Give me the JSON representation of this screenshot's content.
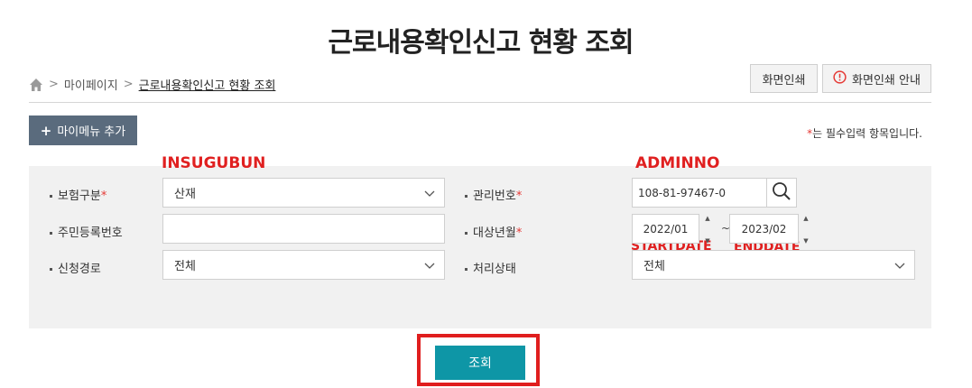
{
  "page": {
    "title": "근로내용확인신고 현황 조회"
  },
  "breadcrumb": {
    "items": [
      "마이페이지",
      "근로내용확인신고 현황 조회"
    ]
  },
  "toolbar": {
    "print_label": "화면인쇄",
    "print_guide_label": "화면인쇄 안내"
  },
  "mymenu": {
    "add_label": "마이메뉴 추가"
  },
  "notice": {
    "required_mark": "*",
    "required_text": "는 필수입력 항목입니다."
  },
  "annotations": {
    "insugubun": "INSUGUBUN",
    "adminno": "ADMINNO",
    "startdate": "STARTDATE",
    "enddate": "ENDDATE"
  },
  "form": {
    "insurance_type": {
      "label": "보험구분",
      "required": "*",
      "value": "산재"
    },
    "resident_no": {
      "label": "주민등록번호",
      "value": ""
    },
    "channel": {
      "label": "신청경로",
      "value": "전체"
    },
    "admin_no": {
      "label": "관리번호",
      "required": "*",
      "value": "108-81-97467-0"
    },
    "target_month": {
      "label": "대상년월",
      "required": "*",
      "start": "2022/01",
      "end": "2023/02",
      "separator": "~"
    },
    "status": {
      "label": "처리상태",
      "value": "전체"
    }
  },
  "actions": {
    "search_label": "조회"
  },
  "colors": {
    "accent": "#0e96a6",
    "annotation": "#e02020",
    "panel_bg": "#f1f1f1",
    "mymenu_bg": "#5a6b7d"
  }
}
